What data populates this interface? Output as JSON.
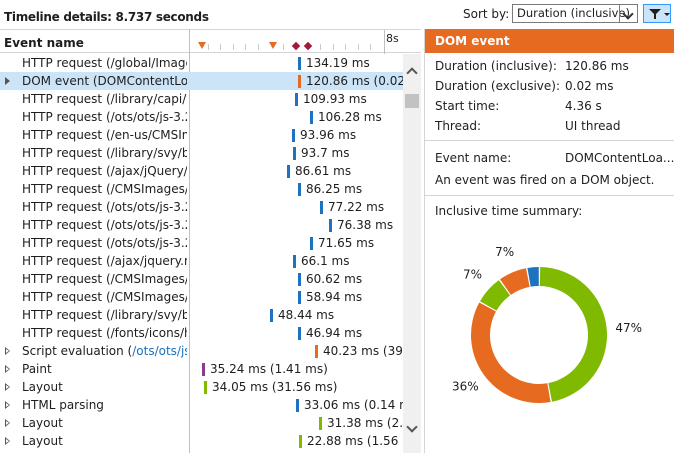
{
  "header": {
    "title": "Timeline details: 8.737 seconds",
    "sort_label": "Sort by:",
    "sort_value": "Duration (inclusive)"
  },
  "list": {
    "column_header": "Event name",
    "ruler_end_label": "8s",
    "rows": [
      {
        "name": "HTTP request (/global/Image...",
        "value": "134.19 ms",
        "bar_color": "#1e73be",
        "expander": false
      },
      {
        "name": "DOM event (DOMContentLo...",
        "value": "120.86 ms (0.02 ms",
        "bar_color": "#e66a1f",
        "expander": true,
        "selected": true
      },
      {
        "name": "HTTP request (/library/capi/w...",
        "value": "109.93 ms",
        "bar_color": "#1e73be",
        "expander": false
      },
      {
        "name": "HTTP request (/ots/ots/js-3.2...",
        "value": "106.28 ms",
        "bar_color": "#1e73be",
        "expander": false
      },
      {
        "name": "HTTP request (/en-us/CMSIm...",
        "value": "93.96 ms",
        "bar_color": "#1e73be",
        "expander": false
      },
      {
        "name": "HTTP request (/library/svy/br...",
        "value": "93.7 ms",
        "bar_color": "#1e73be",
        "expander": false
      },
      {
        "name": "HTTP request (/ajax/jQuery/j...",
        "value": "86.61 ms",
        "bar_color": "#1e73be",
        "expander": false
      },
      {
        "name": "HTTP request (/CMSImages/...",
        "value": "86.25 ms",
        "bar_color": "#1e73be",
        "expander": false
      },
      {
        "name": "HTTP request (/ots/ots/js-3.2...",
        "value": "77.22 ms",
        "bar_color": "#1e73be",
        "expander": false
      },
      {
        "name": "HTTP request (/ots/ots/js-3.2...",
        "value": "76.38 ms",
        "bar_color": "#1e73be",
        "expander": false
      },
      {
        "name": "HTTP request (/ots/ots/js-3.2...",
        "value": "71.65 ms",
        "bar_color": "#1e73be",
        "expander": false
      },
      {
        "name": "HTTP request (/ajax/jquery.m...",
        "value": "66.1 ms",
        "bar_color": "#1e73be",
        "expander": false
      },
      {
        "name": "HTTP request (/CMSImages/...",
        "value": "60.62 ms",
        "bar_color": "#1e73be",
        "expander": false
      },
      {
        "name": "HTTP request (/CMSImages/...",
        "value": "58.94 ms",
        "bar_color": "#1e73be",
        "expander": false
      },
      {
        "name": "HTTP request (/library/svy/br...",
        "value": "48.44 ms",
        "bar_color": "#1e73be",
        "expander": false
      },
      {
        "name": "HTTP request (/fonts/icons/h...",
        "value": "46.94 ms",
        "bar_color": "#1e73be",
        "expander": false
      },
      {
        "name": "Script evaluation (",
        "link": "/ots/ots/js-",
        "value": "40.23 ms (39.1",
        "bar_color": "#e66a1f",
        "expander": true
      },
      {
        "name": "Paint",
        "value": "35.24 ms (1.41 ms)",
        "bar_color": "#8b3a8f",
        "expander": true
      },
      {
        "name": "Layout",
        "value": "34.05 ms (31.56 ms)",
        "bar_color": "#7fba00",
        "expander": true
      },
      {
        "name": "HTML parsing",
        "value": "33.06 ms (0.14 ms)",
        "bar_color": "#1e73be",
        "expander": true
      },
      {
        "name": "Layout",
        "value": "31.38 ms (2.19",
        "bar_color": "#7fba00",
        "expander": true
      },
      {
        "name": "Layout",
        "value": "22.88 ms (1.56 ms",
        "bar_color": "#7fba00",
        "expander": true
      }
    ]
  },
  "details": {
    "title": "DOM event",
    "fields": [
      {
        "label": "Duration (inclusive):",
        "value": "120.86 ms"
      },
      {
        "label": "Duration (exclusive):",
        "value": "0.02 ms"
      },
      {
        "label": "Start time:",
        "value": "4.36 s"
      },
      {
        "label": "Thread:",
        "value": "UI thread"
      }
    ],
    "event_name_label": "Event name:",
    "event_name_value": "DOMContentLoa...",
    "description": "An event was fired on a DOM object.",
    "summary_label": "Inclusive time summary:",
    "chart_data": {
      "type": "pie",
      "donut": true,
      "title": "",
      "categories": [
        "Green",
        "Orange",
        "Green-2",
        "Orange-2",
        "Blue"
      ],
      "values": [
        47,
        36,
        7,
        7,
        3
      ],
      "colors": [
        "#7fba00",
        "#e66a1f",
        "#7fba00",
        "#e66a1f",
        "#1e73be"
      ],
      "labels": [
        "47%",
        "36%",
        "7%",
        "7%"
      ]
    }
  }
}
